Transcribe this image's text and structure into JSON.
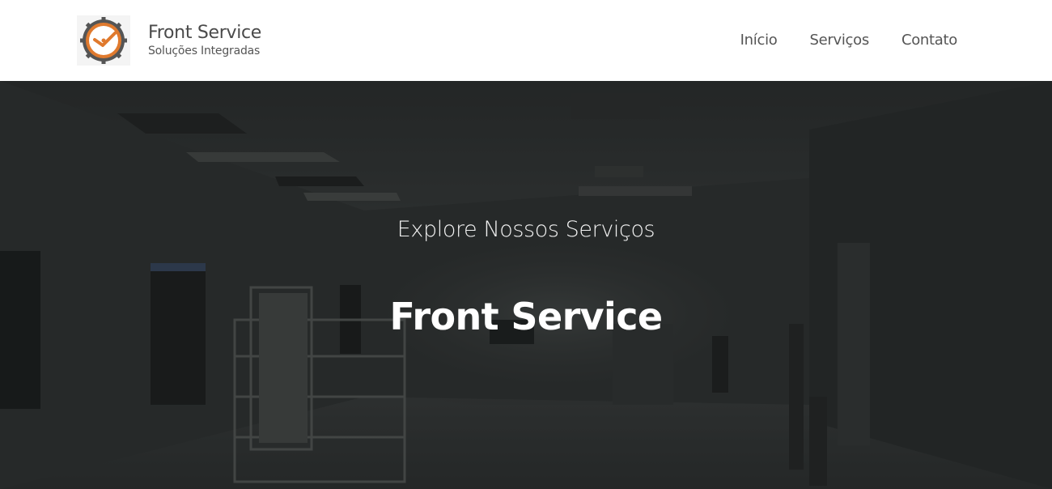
{
  "header": {
    "brand_name": "Front Service",
    "brand_tagline": "Soluções Integradas",
    "logo_icon": "clock-gear-icon",
    "nav": [
      {
        "label": "Início"
      },
      {
        "label": "Serviços"
      },
      {
        "label": "Contato"
      }
    ]
  },
  "hero": {
    "subtitle": "Explore Nossos Serviços",
    "title": "Front Service",
    "background": "cleanroom-photo"
  },
  "colors": {
    "accent": "#e07a2e",
    "header_bg": "#ffffff",
    "hero_bg": "#2b2d2d",
    "text_dark": "#4a4a4a"
  }
}
